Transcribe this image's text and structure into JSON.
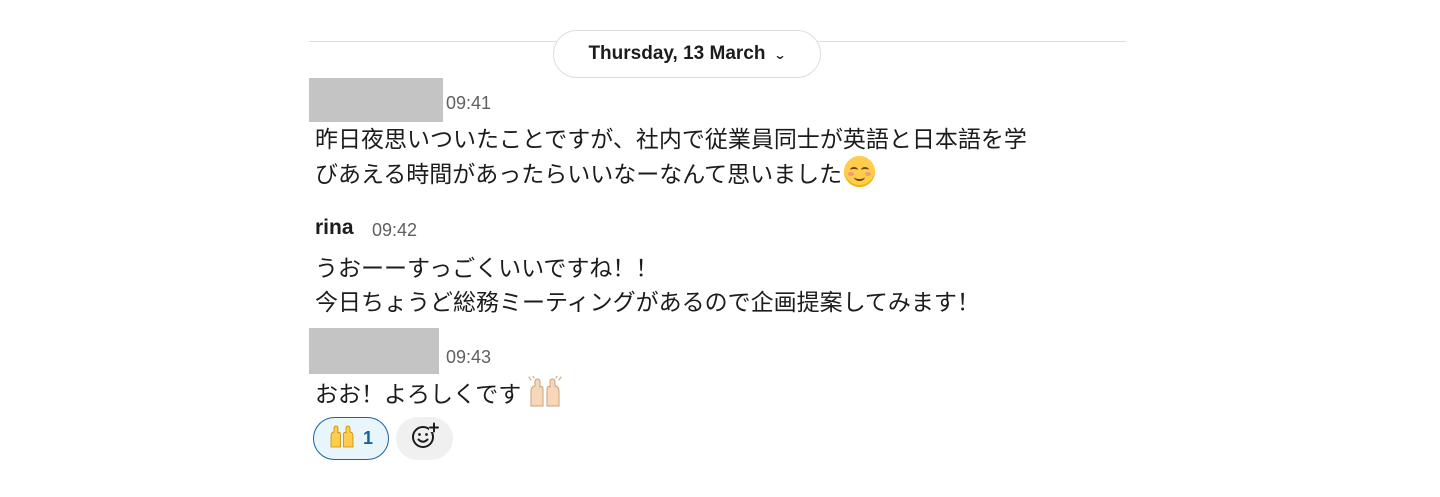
{
  "date_divider": {
    "label": "Thursday, 13 March",
    "chevron_icon": "chevron-down-icon"
  },
  "messages": [
    {
      "author": "",
      "author_redacted": true,
      "time": "09:41",
      "lines": [
        "昨日夜思いついたことですが、社内で従業員同士が英語と日本語を学",
        "びあえる時間があったらいいなーなんて思いました"
      ],
      "trailing_emoji": "smiling-face-icon"
    },
    {
      "author": "rina",
      "author_redacted": false,
      "time": "09:42",
      "lines": [
        "うおーーすっごくいいですね！！",
        "今日ちょうど総務ミーティングがあるので企画提案してみます！"
      ]
    },
    {
      "author": "",
      "author_redacted": true,
      "time": "09:43",
      "lines": [
        "おお！よろしくです"
      ],
      "trailing_emoji": "raising-hands-icon"
    }
  ],
  "reactions": [
    {
      "emoji": "raising-hands-icon",
      "count": "1",
      "selected": true
    }
  ],
  "add_reaction_icon": "add-reaction-icon",
  "colors": {
    "accent": "#1264a3",
    "reaction_bg": "#e8f5fa",
    "redaction": "#c4c4c4",
    "timestamp": "#616061"
  }
}
